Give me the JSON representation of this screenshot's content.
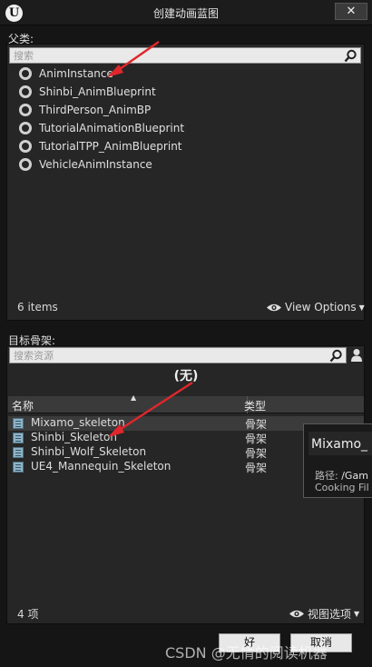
{
  "window": {
    "title": "创建动画蓝图",
    "close_label": "✕",
    "logo_text": "U"
  },
  "parent_section": {
    "label": "父类:",
    "search_placeholder": "搜索",
    "items": [
      {
        "label": "AnimInstance"
      },
      {
        "label": "Shinbi_AnimBlueprint"
      },
      {
        "label": "ThirdPerson_AnimBP"
      },
      {
        "label": "TutorialAnimationBlueprint"
      },
      {
        "label": "TutorialTPP_AnimBlueprint"
      },
      {
        "label": "VehicleAnimInstance"
      }
    ],
    "count": "6 items",
    "view_options": "View Options"
  },
  "skeleton_section": {
    "label": "目标骨架:",
    "search_placeholder": "搜索资源",
    "selected_value": "(无)",
    "columns": {
      "name": "名称",
      "type": "类型"
    },
    "rows": [
      {
        "name": "Mixamo_skeleton",
        "type": "骨架"
      },
      {
        "name": "Shinbi_Skeleton",
        "type": "骨架"
      },
      {
        "name": "Shinbi_Wolf_Skeleton",
        "type": "骨架"
      },
      {
        "name": "UE4_Mannequin_Skeleton",
        "type": "骨架"
      }
    ],
    "count": "4 项",
    "view_options": "视图选项"
  },
  "tooltip": {
    "title": "Mixamo_",
    "path_label": "路径:",
    "path_value": "/Gam",
    "cooking_label": "Cooking Fil"
  },
  "buttons": {
    "ok": "好",
    "cancel": "取消"
  },
  "watermark": "CSDN @无情的阅读机器",
  "colors": {
    "background": "#151515",
    "panel": "#262626",
    "annotation_arrow": "#e0262c"
  }
}
